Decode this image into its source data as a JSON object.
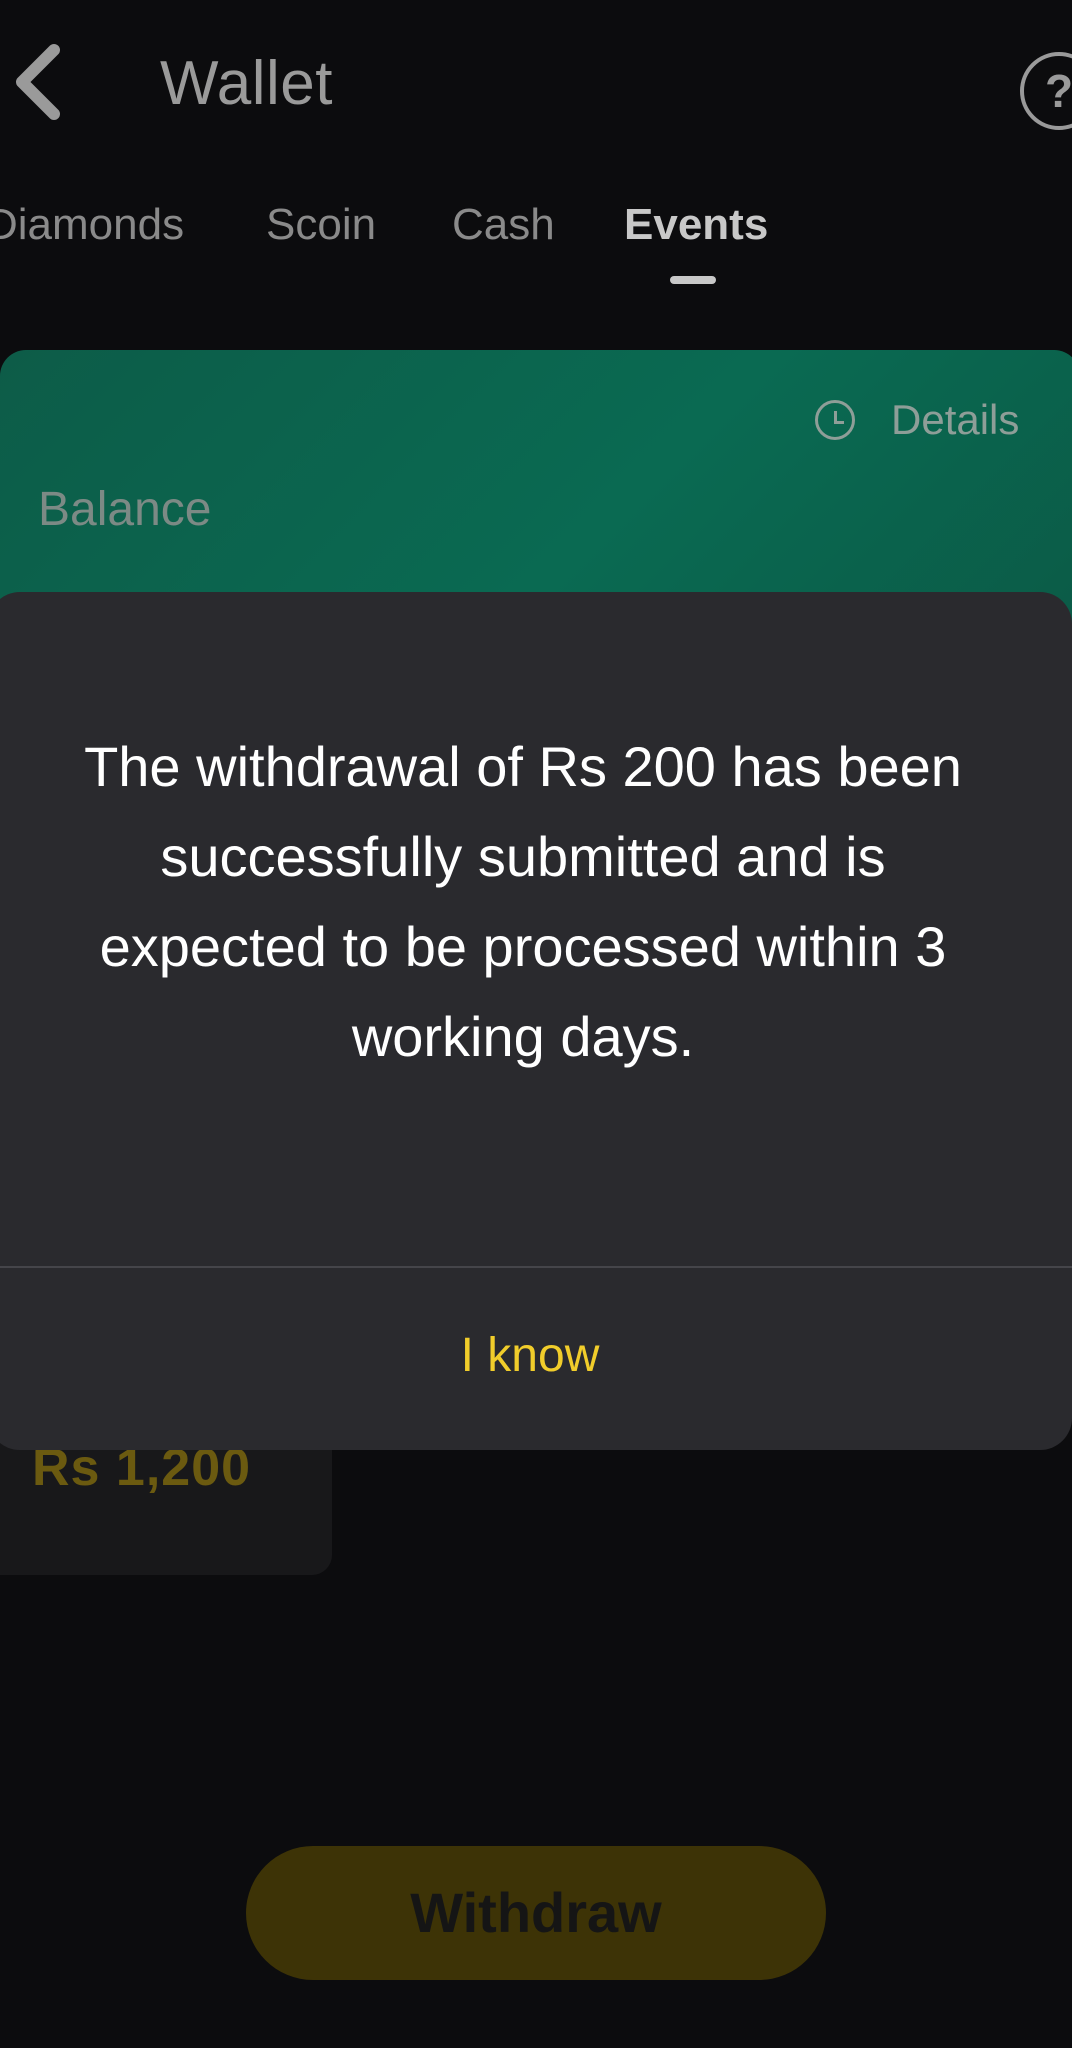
{
  "header": {
    "title": "Wallet",
    "help_symbol": "?"
  },
  "tabs": [
    {
      "label": "Diamonds",
      "active": false
    },
    {
      "label": "Scoin",
      "active": false
    },
    {
      "label": "Cash",
      "active": false
    },
    {
      "label": "Events",
      "active": true
    }
  ],
  "balance_card": {
    "label": "Balance",
    "details_label": "Details"
  },
  "event_card": {
    "amount": "Rs 1,200"
  },
  "withdraw": {
    "label": "Withdraw"
  },
  "dialog": {
    "message": "The withdrawal of Rs 200 has been successfully submitted and is expected to be processed within 3 working days.",
    "button_label": "I know"
  },
  "colors": {
    "accent": "#f1cd2b",
    "card_green": "#0a6a52",
    "dialog_bg": "#2a2a2e",
    "background": "#0c0c0e"
  }
}
